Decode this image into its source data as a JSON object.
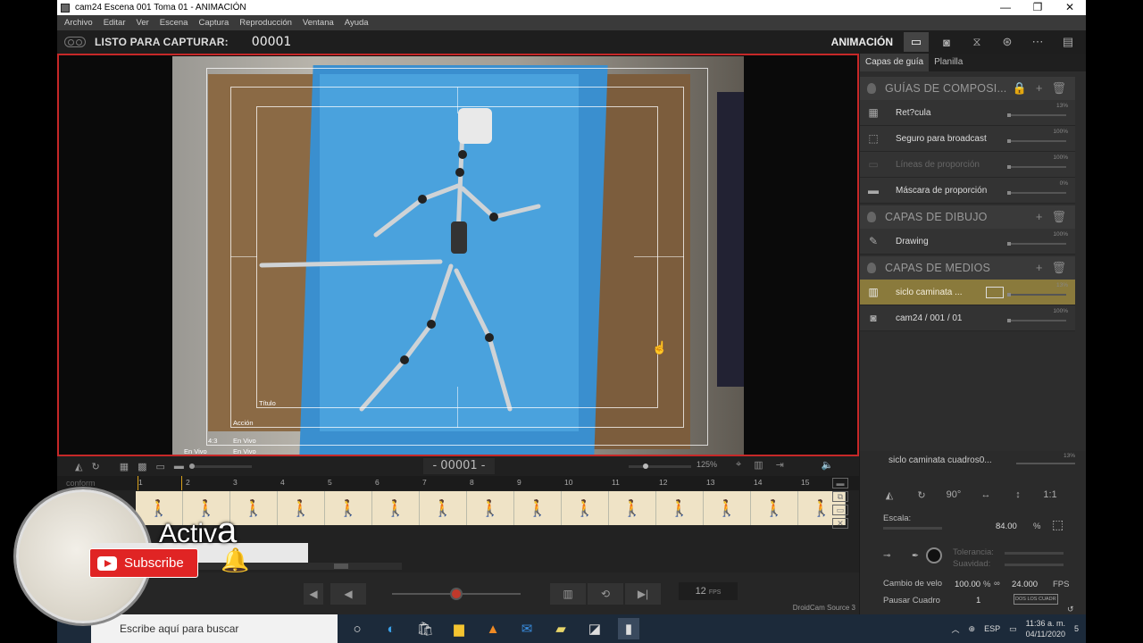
{
  "window": {
    "title": "cam24  Escena 001  Toma 01 - ANIMACIÓN",
    "buttons": [
      "—",
      "❐",
      "✕"
    ]
  },
  "menu": [
    "Archivo",
    "Editar",
    "Ver",
    "Escena",
    "Captura",
    "Reproducción",
    "Ventana",
    "Ayuda"
  ],
  "capture": {
    "label": "LISTO PARA CAPTURAR:",
    "frame": "00001",
    "mode": "ANIMACIÓN"
  },
  "viewer": {
    "labels": {
      "titulo": "Título",
      "accion": "Acción",
      "ratio": "4:3",
      "envivo": "En Vivo"
    },
    "frame_counter": "- 00001 -",
    "zoom": "125%"
  },
  "timeline": {
    "conform_label": "conform",
    "frame_numbers": [
      "1",
      "2",
      "3",
      "4",
      "5",
      "6",
      "7",
      "8",
      "9",
      "10",
      "11",
      "12",
      "13",
      "14",
      "15"
    ]
  },
  "transport": {
    "fps": "12",
    "fps_unit": "FPS",
    "source": "DroidCam Source 3"
  },
  "right_panel": {
    "tabs": [
      "Capas de guía",
      "Planilla"
    ],
    "sections": [
      {
        "title": "GUÍAS DE COMPOSI...",
        "layers": [
          {
            "name": "Ret?cula",
            "pct": "13%",
            "icon": "grid-icon"
          },
          {
            "name": "Seguro para broadcast",
            "pct": "100%",
            "icon": "safe-area-icon"
          },
          {
            "name": "Líneas de proporción",
            "pct": "100%",
            "icon": "ratio-lines-icon",
            "dim": true
          },
          {
            "name": "Máscara de proporción",
            "pct": "0%",
            "icon": "mask-icon"
          }
        ]
      },
      {
        "title": "CAPAS DE DIBUJO",
        "layers": [
          {
            "name": "Drawing",
            "pct": "100%",
            "icon": "pencil-icon"
          }
        ]
      },
      {
        "title": "CAPAS DE MEDIOS",
        "layers": [
          {
            "name": "siclo caminata ...",
            "pct": "13%",
            "icon": "film-icon",
            "selected": true
          },
          {
            "name": "cam24 / 001 / 01",
            "pct": "100%",
            "icon": "camera-icon"
          }
        ]
      }
    ]
  },
  "right_bottom": {
    "layer_name": "siclo caminata cuadros0...",
    "layer_pct": "13%",
    "rotate_label": "90°",
    "ratio_label": "1:1",
    "scale_label": "Escala:",
    "scale_value": "84.00",
    "scale_unit": "%",
    "tolerance_label": "Tolerancia:",
    "smoothness_label": "Suavidad:",
    "speed_label": "Cambio de velo",
    "speed_value": "100.00",
    "speed_unit": "%",
    "fps_value": "24.000",
    "fps_unit": "FPS",
    "pause_label": "Pausar Cuadro",
    "pause_value": "1",
    "both_frames": "DOS LOS CUADR"
  },
  "taskbar": {
    "search_placeholder": "Escribe aquí para buscar",
    "lang": "ESP",
    "time": "11:36 a. m.",
    "date": "04/11/2020",
    "notifications": "5"
  },
  "overlay": {
    "activa": "Activ",
    "activa_big": "a",
    "subscribe": "Subscribe"
  },
  "colors": {
    "accent_red": "#c62828",
    "selected_layer": "#8a7a3c",
    "subscribe_red": "#e02424"
  }
}
